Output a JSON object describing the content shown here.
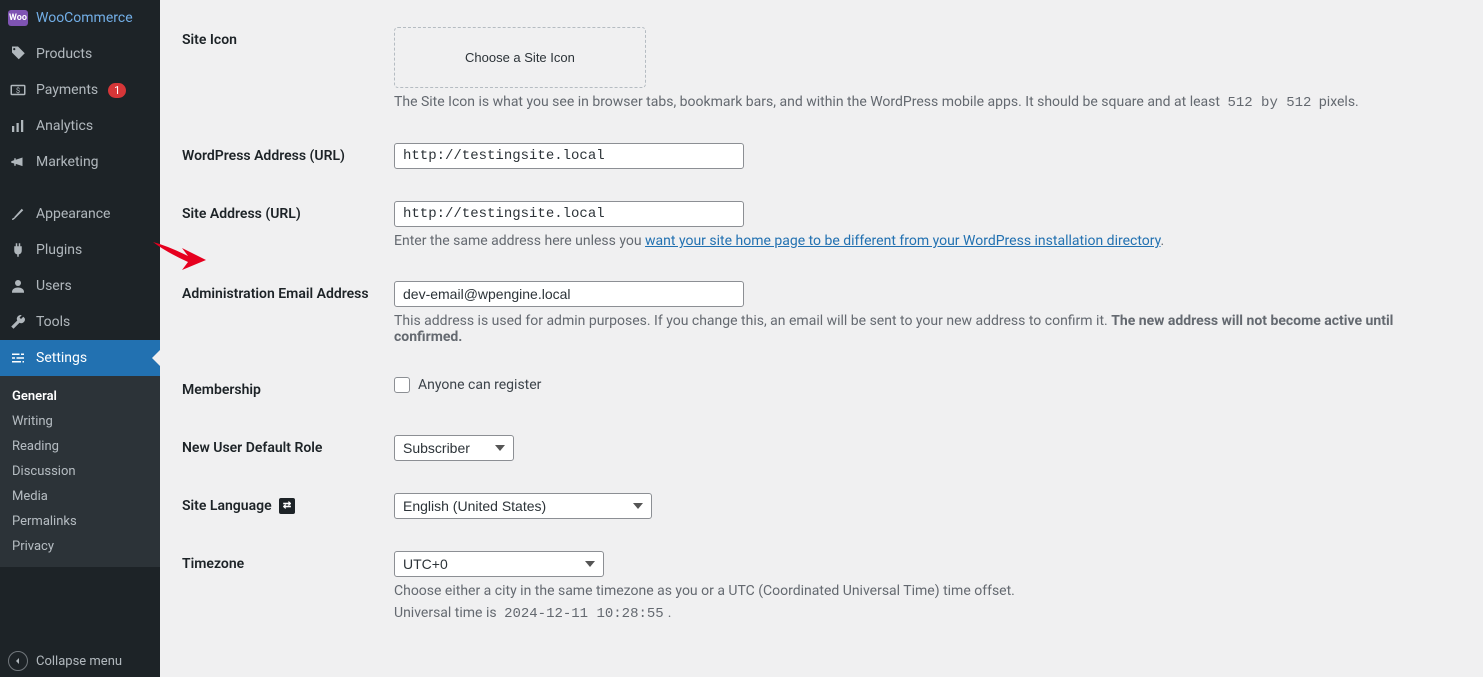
{
  "sidebar": {
    "items": [
      {
        "label": "WooCommerce",
        "icon": "woo"
      },
      {
        "label": "Products",
        "icon": "tag"
      },
      {
        "label": "Payments",
        "icon": "payments",
        "badge": "1"
      },
      {
        "label": "Analytics",
        "icon": "analytics"
      },
      {
        "label": "Marketing",
        "icon": "marketing"
      },
      {
        "label": "Appearance",
        "icon": "appearance"
      },
      {
        "label": "Plugins",
        "icon": "plugins"
      },
      {
        "label": "Users",
        "icon": "users"
      },
      {
        "label": "Tools",
        "icon": "tools"
      },
      {
        "label": "Settings",
        "icon": "settings"
      }
    ],
    "submenu": [
      {
        "label": "General",
        "current": true
      },
      {
        "label": "Writing"
      },
      {
        "label": "Reading"
      },
      {
        "label": "Discussion"
      },
      {
        "label": "Media"
      },
      {
        "label": "Permalinks"
      },
      {
        "label": "Privacy"
      }
    ],
    "collapse_label": "Collapse menu"
  },
  "form": {
    "site_icon": {
      "label": "Site Icon",
      "button": "Choose a Site Icon",
      "desc_pre": "The Site Icon is what you see in browser tabs, bookmark bars, and within the WordPress mobile apps. It should be square and at least ",
      "desc_code": "512 by 512",
      "desc_post": " pixels."
    },
    "wp_address": {
      "label": "WordPress Address (URL)",
      "value": "http://testingsite.local"
    },
    "site_address": {
      "label": "Site Address (URL)",
      "value": "http://testingsite.local",
      "desc_pre": "Enter the same address here unless you ",
      "desc_link": "want your site home page to be different from your WordPress installation directory",
      "desc_post": "."
    },
    "admin_email": {
      "label": "Administration Email Address",
      "value": "dev-email@wpengine.local",
      "desc_pre": "This address is used for admin purposes. If you change this, an email will be sent to your new address to confirm it. ",
      "desc_bold": "The new address will not become active until confirmed."
    },
    "membership": {
      "label": "Membership",
      "checkbox_label": "Anyone can register"
    },
    "default_role": {
      "label": "New User Default Role",
      "value": "Subscriber"
    },
    "language": {
      "label": "Site Language",
      "value": "English (United States)"
    },
    "timezone": {
      "label": "Timezone",
      "value": "UTC+0",
      "desc": "Choose either a city in the same timezone as you or a UTC (Coordinated Universal Time) time offset.",
      "ut_pre": "Universal time is ",
      "ut_code": "2024-12-11 10:28:55",
      "ut_post": "."
    }
  }
}
